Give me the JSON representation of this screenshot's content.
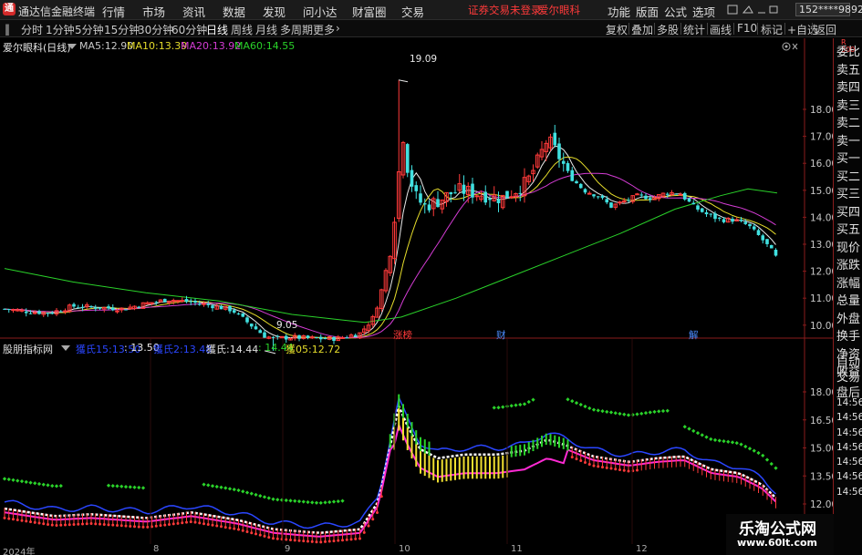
{
  "titlebar": {
    "app_title": "通达信金融终端",
    "menu": [
      "行情",
      "市场",
      "资讯",
      "数据",
      "发现",
      "问小达",
      "财富圈",
      "交易"
    ],
    "warning": "证券交易未登录",
    "stock_name": "爱尔眼科",
    "right_menu": [
      "功能",
      "版面",
      "公式",
      "选项"
    ],
    "user": "152****9892"
  },
  "toolbar": {
    "periods": [
      "分时",
      "1分钟",
      "5分钟",
      "15分钟",
      "30分钟",
      "60分钟",
      "日线",
      "周线",
      "月线",
      "多周期",
      "更多"
    ],
    "active_period": "日线",
    "right_tools": [
      "复权",
      "叠加",
      "多股",
      "统计",
      "画线",
      "F10",
      "标记",
      "+自选",
      "返回"
    ]
  },
  "main_panel": {
    "title": "爱尔眼科(日线)",
    "ma": [
      {
        "label": "MA5:",
        "value": "12.90",
        "color": "#e8e8e8"
      },
      {
        "label": "MA10:",
        "value": "13.39",
        "color": "#e6dd2b"
      },
      {
        "label": "MA20:",
        "value": "13.92",
        "color": "#d43cd4"
      },
      {
        "label": "MA60:",
        "value": "14.55",
        "color": "#2ad22a"
      }
    ],
    "high_label": "19.09",
    "low_label": "9.05",
    "events": [
      "涨榜",
      "财",
      "解"
    ]
  },
  "indicator_panel": {
    "title": "股朋指标网",
    "lines": [
      {
        "label": "獲氏15:",
        "value": "13.50",
        "color": "#2a46ff"
      },
      {
        "label": "獲氏2:",
        "value": "13.48",
        "color": "#2a46ff"
      },
      {
        "label": "獲氏:",
        "value": "14.44",
        "color": "#e0e0e0"
      },
      {
        "label": "",
        "value": "14.44",
        "color": "#2ad22a"
      },
      {
        "label": "獲05:",
        "value": "12.72",
        "color": "#e6dd2b"
      }
    ],
    "watermark_line1": "乐淘公式网",
    "watermark_line2": "www.60lt.com"
  },
  "chart_data": [
    {
      "type": "candlestick",
      "title": "爱尔眼科(日线)",
      "ylim": [
        9.0,
        19.6
      ],
      "yticks": [
        "18.00",
        "17.00",
        "16.00",
        "15.00",
        "14.00",
        "13.00",
        "12.00",
        "11.00",
        "10.00"
      ],
      "series": [
        {
          "name": "MA5",
          "color": "#e8e8e8"
        },
        {
          "name": "MA10",
          "color": "#e6dd2b"
        },
        {
          "name": "MA20",
          "color": "#d43cd4"
        },
        {
          "name": "MA60",
          "color": "#2ad22a"
        }
      ],
      "price_labels": {
        "high": 19.09,
        "low": 9.05
      },
      "last_close": 12.45
    },
    {
      "type": "line",
      "title": "股朋指标网",
      "yticks": [
        "18.00",
        "16.50",
        "15.00",
        "13.50",
        "12.00"
      ]
    }
  ],
  "side_panel": {
    "quote_items": [
      "委比",
      "卖五",
      "卖四",
      "卖三",
      "卖二",
      "卖一",
      "买一",
      "买二",
      "买三",
      "买四",
      "买五",
      "现价",
      "涨跌",
      "涨幅",
      "总量",
      "外盘",
      "换手",
      "净资",
      "收益"
    ],
    "bottom_items": [
      "自动",
      "交易",
      "盘后",
      "14:56",
      "14:56",
      "14:56",
      "14:56",
      "14:56",
      "14:56",
      "14:56"
    ]
  },
  "xaxis": [
    "2024年",
    "8",
    "9",
    "10",
    "11",
    "12"
  ]
}
